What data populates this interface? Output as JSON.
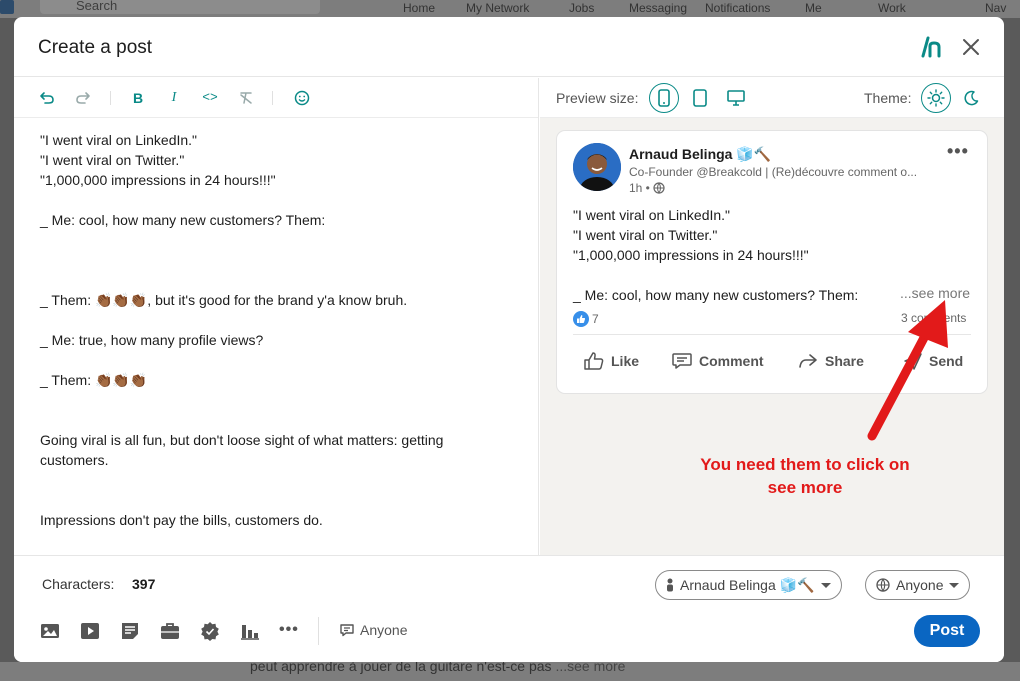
{
  "background": {
    "search_placeholder": "Search",
    "nav_items": [
      "Home",
      "My Network",
      "Jobs",
      "Messaging",
      "Notifications",
      "Me",
      "Work",
      "Nav"
    ],
    "feed_snippet": "peut apprendre à jouer de la guitare n'est-ce pas",
    "feed_see_more": "...see more"
  },
  "modal": {
    "title": "Create a post",
    "close_icon": "close-icon",
    "brand_icon": "brand-logo-icon"
  },
  "toolbar": {
    "icons": [
      "undo-icon",
      "redo-icon",
      "bold-icon",
      "italic-icon",
      "code-icon",
      "clear-format-icon",
      "emoji-icon"
    ]
  },
  "editor": {
    "lines": [
      "\"I went viral on LinkedIn.\"",
      "\"I went viral on Twitter.\"",
      "\"1,000,000 impressions in 24 hours!!!\"",
      "",
      "_ Me: cool, how many new customers? Them:",
      "",
      "",
      "",
      "_ Them: 👏🏾👏🏾👏🏾, but it's good for the brand y'a know bruh.",
      "",
      "_ Me: true, how many profile views?",
      "",
      "_ Them: 👏🏾👏🏾👏🏾",
      "",
      "",
      "Going viral is all fun, but don't loose sight of what matters: getting",
      "customers.",
      "",
      "",
      "Impressions don't pay the bills, customers do."
    ]
  },
  "preview": {
    "size_label": "Preview size:",
    "theme_label": "Theme:",
    "size_options": [
      "mobile",
      "tablet",
      "desktop"
    ],
    "active_size": "mobile",
    "active_theme": "light"
  },
  "post": {
    "author": "Arnaud Belinga 🧊🔨",
    "headline": "Co-Founder @Breakcold | (Re)découvre comment o...",
    "time": "1h •",
    "lines": [
      "\"I went viral on LinkedIn.\"",
      "\"I went viral on Twitter.\"",
      "\"1,000,000 impressions in 24 hours!!!\"",
      "",
      "_ Me: cool, how many new customers? Them:"
    ],
    "see_more": "...see more",
    "reaction_count": "7",
    "comments": "3 comments",
    "actions": {
      "like": "Like",
      "comment": "Comment",
      "share": "Share",
      "send": "Send"
    }
  },
  "annotation": {
    "line1": "You need them to click on",
    "line2": "see more",
    "color": "#e21a1a"
  },
  "footer": {
    "characters_label": "Characters:",
    "characters_value": "397",
    "account_selector": "Arnaud Belinga 🧊🔨",
    "visibility_selector": "Anyone",
    "audience_label": "Anyone",
    "post_label": "Post",
    "attachment_icons": [
      "image-icon",
      "video-icon",
      "document-icon",
      "job-icon",
      "badge-icon",
      "poll-icon",
      "more-icon"
    ]
  },
  "colors": {
    "accent": "#0a8a87",
    "post_button": "#0a66c2",
    "preview_bg": "#f3f2ef"
  }
}
